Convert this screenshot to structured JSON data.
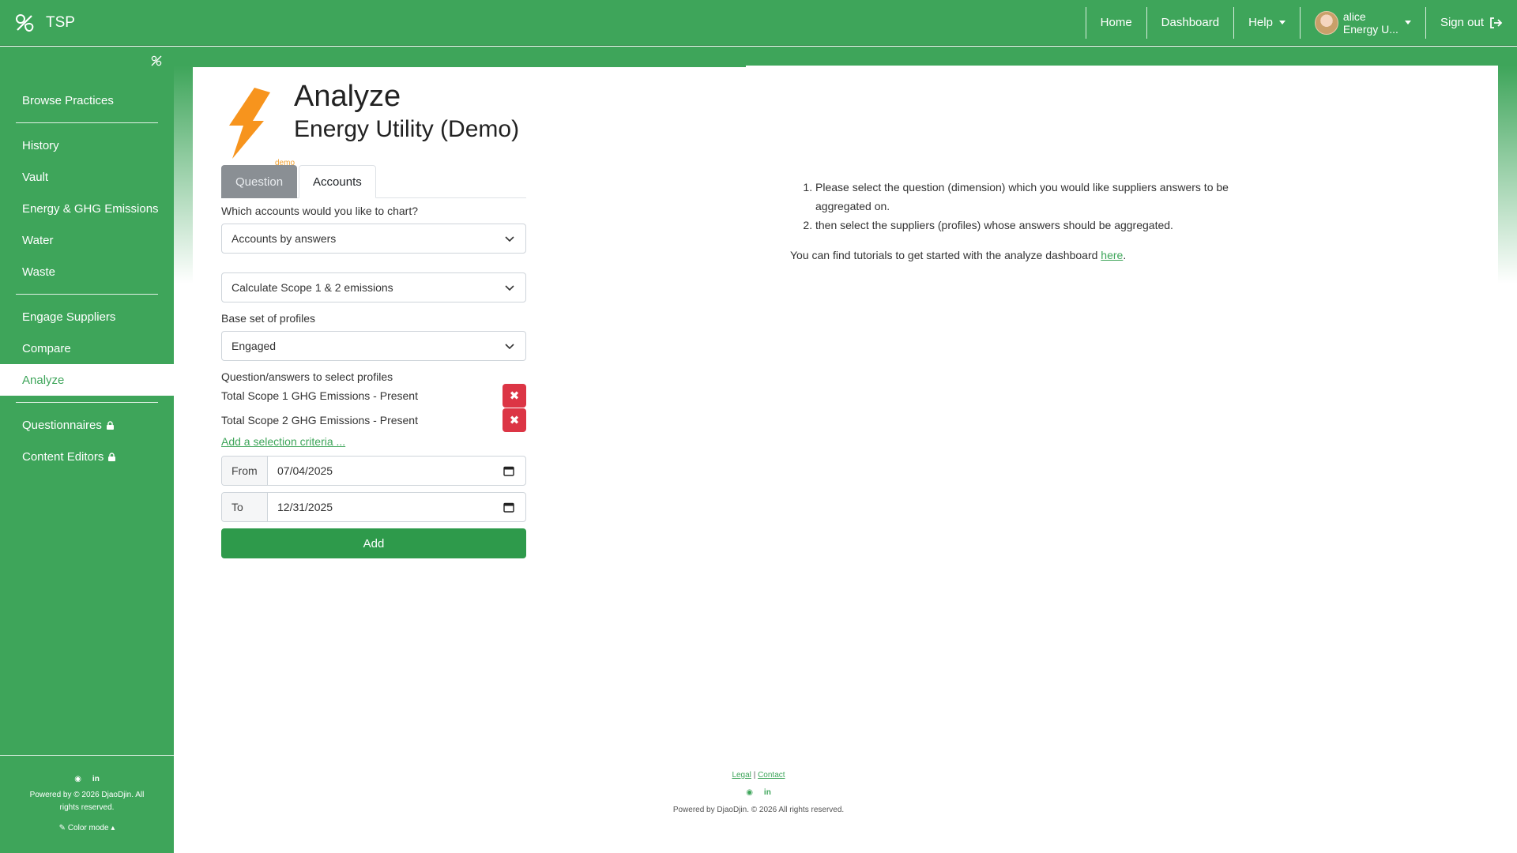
{
  "topbar": {
    "brand": "TSP",
    "nav": {
      "home": "Home",
      "dashboard": "Dashboard",
      "help": "Help",
      "user_name": "alice",
      "user_org": "Energy U...",
      "signout": "Sign out"
    }
  },
  "sidebar": {
    "items": [
      {
        "label": "Browse Practices"
      },
      {
        "label": "History"
      },
      {
        "label": "Vault"
      },
      {
        "label": "Energy & GHG Emissions"
      },
      {
        "label": "Water"
      },
      {
        "label": "Waste"
      },
      {
        "label": "Engage Suppliers"
      },
      {
        "label": "Compare"
      },
      {
        "label": "Analyze"
      },
      {
        "label": "Questionnaires"
      },
      {
        "label": "Content Editors"
      }
    ],
    "footer": {
      "powered": "Powered by © 2026 DjaoDjin. All rights reserved.",
      "color_mode": "Color mode"
    }
  },
  "header": {
    "title": "Analyze",
    "subtitle": "Energy Utility (Demo)",
    "demo_tag": "demo"
  },
  "tabs": {
    "question": "Question",
    "accounts": "Accounts"
  },
  "form": {
    "accounts_label": "Which accounts would you like to chart?",
    "accounts_select": "Accounts by answers",
    "calc_select": "Calculate Scope 1 & 2 emissions",
    "base_label": "Base set of profiles",
    "base_select": "Engaged",
    "criteria_label": "Question/answers to select profiles",
    "criteria": [
      {
        "text": "Total Scope 1 GHG Emissions - Present"
      },
      {
        "text": "Total Scope 2 GHG Emissions - Present"
      }
    ],
    "add_criteria": "Add a selection criteria ...",
    "from_label": "From",
    "from_value": "07/04/2025",
    "to_label": "To",
    "to_value": "12/31/2025",
    "add_button": "Add"
  },
  "instructions": {
    "steps": [
      "Please select the question (dimension) which you would like suppliers answers to be aggregated on.",
      "then select the suppliers (profiles) whose answers should be aggregated."
    ],
    "tutorial_text": "You can find tutorials to get started with the analyze dashboard",
    "tutorial_link": "here",
    "tutorial_end": "."
  },
  "footer": {
    "legal": "Legal",
    "sep": "|",
    "contact": "Contact",
    "powered": "Powered by DjaoDjin. © 2026 All rights reserved."
  },
  "colors": {
    "brand_green": "#3ea55a",
    "danger": "#dc3545",
    "bolt_orange": "#f7941d"
  }
}
